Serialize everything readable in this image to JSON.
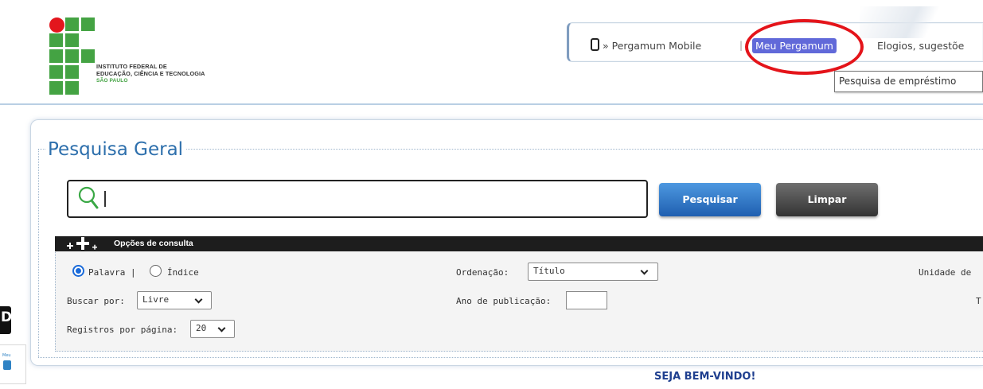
{
  "header": {
    "logo": {
      "line1": "INSTITUTO FEDERAL DE",
      "line2": "EDUCAÇÃO, CIÊNCIA E TECNOLOGIA",
      "line3": "SÃO PAULO",
      "colors": {
        "green": "#44a343",
        "red": "#e3161d"
      }
    },
    "nav": {
      "mobile_label": "» Pergamum Mobile",
      "separator": "|",
      "meu_pergamum_label": "Meu Pergamum",
      "elogios_label": "Elogios, sugestõe"
    },
    "tooltip": "Pesquisa de empréstimo"
  },
  "search": {
    "legend": "Pesquisa Geral",
    "input_value": "",
    "search_button": "Pesquisar",
    "clear_button": "Limpar"
  },
  "options": {
    "title": "Opções de consulta",
    "radio_palavra": "Palavra |",
    "radio_indice": "Índice",
    "selected_radio": "Palavra",
    "ordenacao_label": "Ordenação:",
    "ordenacao_value": "Título",
    "unidade_label": "Unidade de",
    "buscar_label": "Buscar por:",
    "buscar_value": "Livre",
    "ano_label": "Ano de publicação:",
    "ano_value": "",
    "trailing_fragment": "T",
    "registros_label": "Registros por página:",
    "registros_value": "20"
  },
  "edge": {
    "letter": "D",
    "tiny_text": "Meu"
  },
  "welcome": "SEJA BEM-VINDO!",
  "colors": {
    "accent_blue": "#2d6fac",
    "highlight_purple": "#6169d9",
    "annotation_red": "#e4141a",
    "search_icon_green": "#3aa845"
  }
}
